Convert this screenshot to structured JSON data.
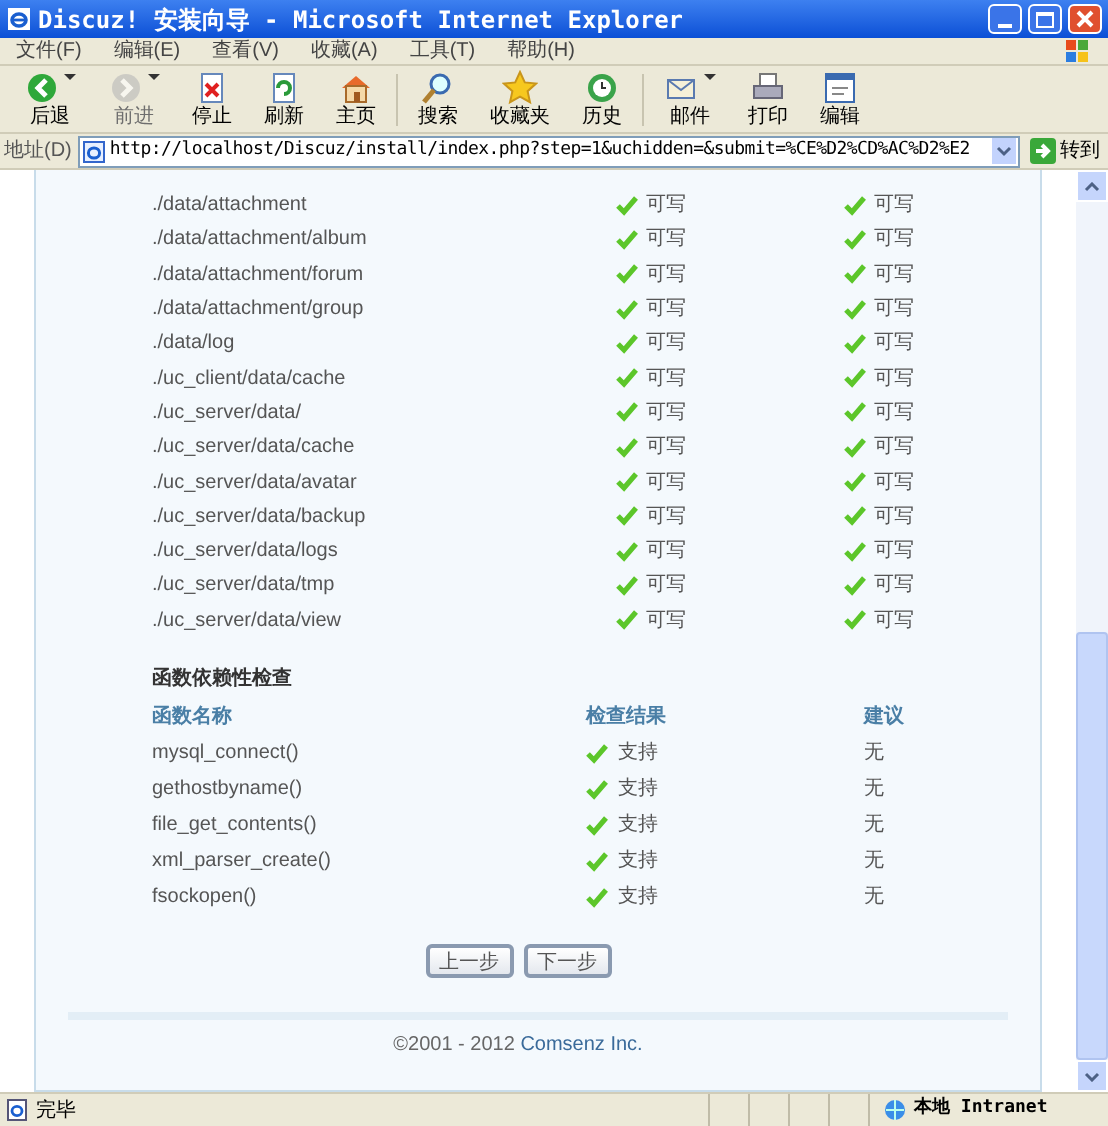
{
  "window": {
    "title": "Discuz! 安装向导 - Microsoft Internet Explorer"
  },
  "menu": [
    "文件(F)",
    "编辑(E)",
    "查看(V)",
    "收藏(A)",
    "工具(T)",
    "帮助(H)"
  ],
  "toolbar": [
    {
      "label": "后退",
      "kind": "back",
      "disabled": false,
      "dropdown": true
    },
    {
      "label": "前进",
      "kind": "forward",
      "disabled": true,
      "dropdown": true
    },
    {
      "label": "停止",
      "kind": "stop",
      "disabled": false,
      "dropdown": false
    },
    {
      "label": "刷新",
      "kind": "refresh",
      "disabled": false,
      "dropdown": false
    },
    {
      "label": "主页",
      "kind": "home",
      "disabled": false,
      "dropdown": false,
      "separator_after": true
    },
    {
      "label": "搜索",
      "kind": "search",
      "disabled": false,
      "dropdown": false
    },
    {
      "label": "收藏夹",
      "kind": "favorites",
      "disabled": false,
      "dropdown": false
    },
    {
      "label": "历史",
      "kind": "history",
      "disabled": false,
      "dropdown": false,
      "separator_after": true
    },
    {
      "label": "邮件",
      "kind": "mail",
      "disabled": false,
      "dropdown": true
    },
    {
      "label": "打印",
      "kind": "print",
      "disabled": false,
      "dropdown": false
    },
    {
      "label": "编辑",
      "kind": "edit",
      "disabled": false,
      "dropdown": false
    }
  ],
  "address_bar": {
    "label": "地址(D)",
    "url": "http://localhost/Discuz/install/index.php?step=1&uchidden=&submit=%CE%D2%CD%AC%D2%E2",
    "go": "转到"
  },
  "directories": [
    {
      "path": "./data/attachment",
      "current": "可写",
      "required": "可写",
      "ok": true
    },
    {
      "path": "./data/attachment/album",
      "current": "可写",
      "required": "可写",
      "ok": true
    },
    {
      "path": "./data/attachment/forum",
      "current": "可写",
      "required": "可写",
      "ok": true
    },
    {
      "path": "./data/attachment/group",
      "current": "可写",
      "required": "可写",
      "ok": true
    },
    {
      "path": "./data/log",
      "current": "可写",
      "required": "可写",
      "ok": true
    },
    {
      "path": "./uc_client/data/cache",
      "current": "可写",
      "required": "可写",
      "ok": true
    },
    {
      "path": "./uc_server/data/",
      "current": "可写",
      "required": "可写",
      "ok": true
    },
    {
      "path": "./uc_server/data/cache",
      "current": "可写",
      "required": "可写",
      "ok": true
    },
    {
      "path": "./uc_server/data/avatar",
      "current": "可写",
      "required": "可写",
      "ok": true
    },
    {
      "path": "./uc_server/data/backup",
      "current": "可写",
      "required": "可写",
      "ok": true
    },
    {
      "path": "./uc_server/data/logs",
      "current": "可写",
      "required": "可写",
      "ok": true
    },
    {
      "path": "./uc_server/data/tmp",
      "current": "可写",
      "required": "可写",
      "ok": true
    },
    {
      "path": "./uc_server/data/view",
      "current": "可写",
      "required": "可写",
      "ok": true
    }
  ],
  "functions": {
    "title": "函数依赖性检查",
    "columns": [
      "函数名称",
      "检查结果",
      "建议"
    ],
    "rows": [
      {
        "name": "mysql_connect()",
        "result": "支持",
        "advice": "无",
        "ok": true
      },
      {
        "name": "gethostbyname()",
        "result": "支持",
        "advice": "无",
        "ok": true
      },
      {
        "name": "file_get_contents()",
        "result": "支持",
        "advice": "无",
        "ok": true
      },
      {
        "name": "xml_parser_create()",
        "result": "支持",
        "advice": "无",
        "ok": true
      },
      {
        "name": "fsockopen()",
        "result": "支持",
        "advice": "无",
        "ok": true
      }
    ]
  },
  "buttons": [
    "上一步",
    "下一步"
  ],
  "footer": {
    "text": "©2001 - 2012 ",
    "link": "Comsenz Inc."
  },
  "status_bar": {
    "text": "完毕",
    "zone": "本地 Intranet"
  }
}
